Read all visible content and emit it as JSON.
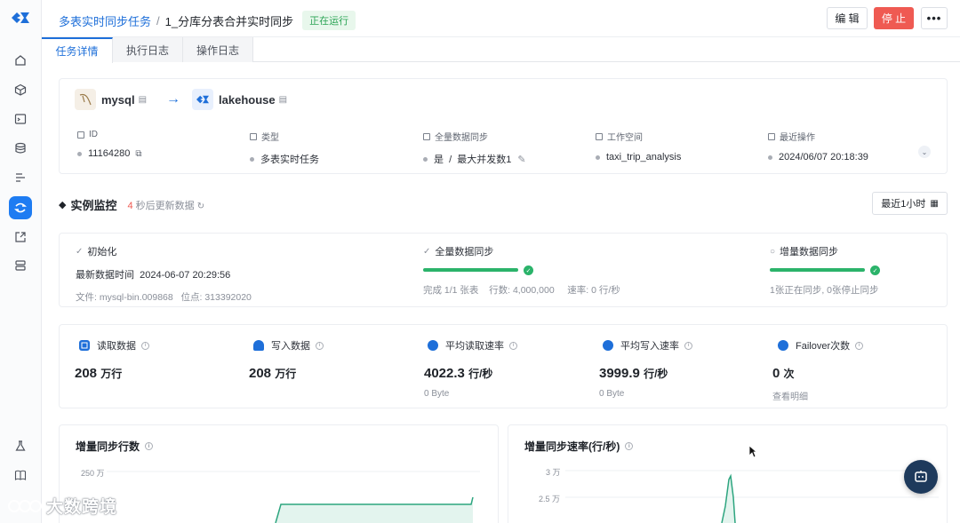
{
  "colors": {
    "primary": "#1e6fd9",
    "danger": "#ef5a52",
    "success": "#2bb36a",
    "rail_active": "#1e7cf2"
  },
  "rail": {
    "items": [
      "home-icon",
      "cube-icon",
      "terminal-icon",
      "database-icon",
      "align-icon",
      "sync-icon-active",
      "export-icon",
      "server-icon",
      "flask-icon",
      "book-icon"
    ]
  },
  "breadcrumb": {
    "parent": "多表实时同步任务",
    "separator": "/",
    "current": "1_分库分表合并实时同步"
  },
  "status_badge": "正在运行",
  "header_actions": {
    "edit": "编 辑",
    "stop": "停 止",
    "more": "•••"
  },
  "tabs": [
    {
      "label": "任务详情",
      "active": true
    },
    {
      "label": "执行日志",
      "active": false
    },
    {
      "label": "操作日志",
      "active": false
    }
  ],
  "source": {
    "name": "mysql",
    "icon": "mysql-icon"
  },
  "arrow": "→",
  "target": {
    "name": "lakehouse",
    "icon": "lakehouse-icon"
  },
  "info": [
    {
      "label": "ID",
      "value": "11164280"
    },
    {
      "label": "类型",
      "value": "多表实时任务"
    },
    {
      "label": "全量数据同步",
      "value": "是  /  最大并发数1"
    },
    {
      "label": "工作空间",
      "value": "taxi_trip_analysis"
    },
    {
      "label": "最近操作",
      "value": "2024/06/07 20:18:39"
    }
  ],
  "monitor": {
    "title": "实例监控",
    "countdown": "4",
    "refresh_text": "秒后更新数据",
    "range_button": "最近1小时"
  },
  "stages": {
    "init": {
      "title": "初始化",
      "latest_label": "最新数据时间",
      "latest_value": "2024-06-07 20:29:56",
      "file_label": "文件:",
      "file_value": "mysql-bin.009868",
      "pos_label": "位点:",
      "pos_value": "313392020"
    },
    "full": {
      "title": "全量数据同步",
      "progress": 1.0,
      "done": "完成 1/1 张表",
      "rows": "行数: 4,000,000",
      "rate": "速率: 0 行/秒"
    },
    "incr": {
      "title": "增量数据同步",
      "progress": 1.0,
      "status": "1张正在同步, 0张停止同步"
    }
  },
  "metrics": [
    {
      "label": "读取数据",
      "value": "208",
      "unit": "万行",
      "sub": ""
    },
    {
      "label": "写入数据",
      "value": "208",
      "unit": "万行",
      "sub": ""
    },
    {
      "label": "平均读取速率",
      "value": "4022.3",
      "unit": "行/秒",
      "sub": "0 Byte"
    },
    {
      "label": "平均写入速率",
      "value": "3999.9",
      "unit": "行/秒",
      "sub": "0 Byte"
    },
    {
      "label": "Failover次数",
      "value": "0",
      "unit": "次",
      "sub": "查看明细"
    }
  ],
  "charts": {
    "left": {
      "title": "增量同步行数",
      "y_tick": "250 万"
    },
    "right": {
      "title": "增量同步速率(行/秒)",
      "y_ticks": [
        "3 万",
        "2.5 万"
      ]
    }
  },
  "chart_data": [
    {
      "type": "area",
      "title": "增量同步行数",
      "y_ticks": [
        "250 万"
      ]
    },
    {
      "type": "line",
      "title": "增量同步速率(行/秒)",
      "y_ticks": [
        "3 万",
        "2.5 万"
      ]
    }
  ],
  "watermark": "大数跨境"
}
